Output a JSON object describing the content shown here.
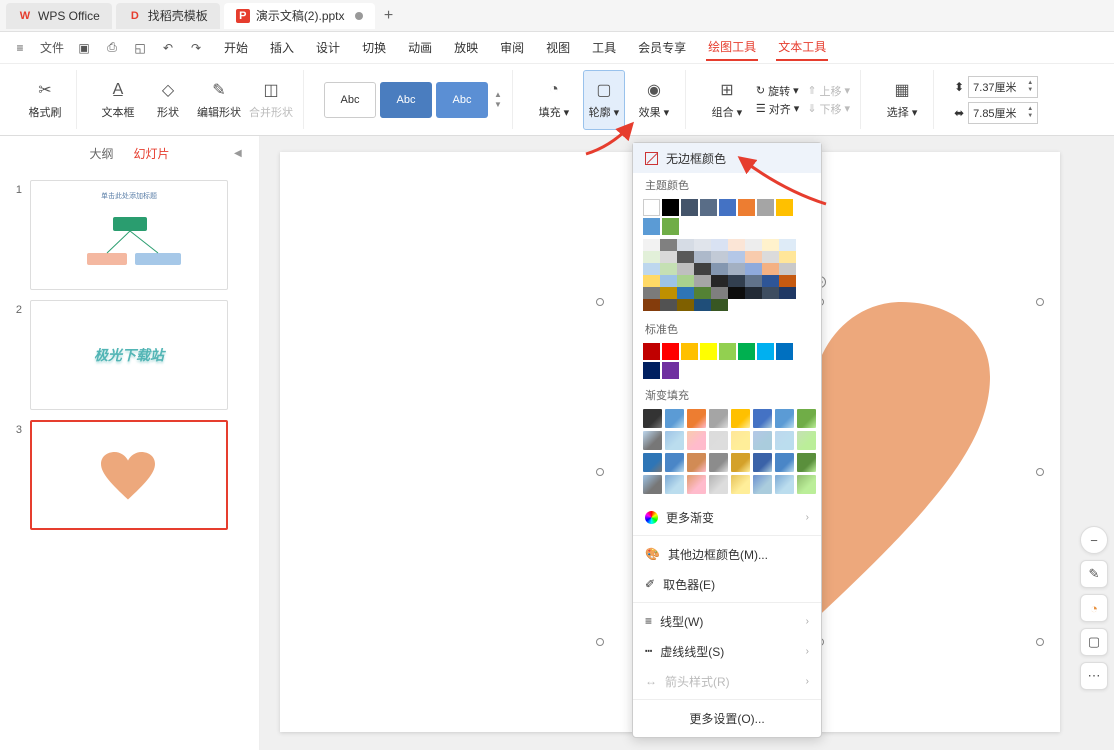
{
  "tabs": {
    "wps": "WPS Office",
    "docer": "找稻壳模板",
    "file": "演示文稿(2).pptx"
  },
  "menu": {
    "file": "文件",
    "items": [
      "开始",
      "插入",
      "设计",
      "切换",
      "动画",
      "放映",
      "审阅",
      "视图",
      "工具",
      "会员专享",
      "绘图工具",
      "文本工具"
    ]
  },
  "ribbon": {
    "format_painter": "格式刷",
    "textbox": "文本框",
    "shapes": "形状",
    "edit_shape": "编辑形状",
    "merge_shape": "合并形状",
    "style_label": "Abc",
    "fill": "填充",
    "outline": "轮廓",
    "effects": "效果",
    "group": "组合",
    "rotate": "旋转",
    "align": "对齐",
    "up": "上移",
    "down": "下移",
    "select": "选择",
    "width": "7.37厘米",
    "height": "7.85厘米"
  },
  "side": {
    "outline": "大纲",
    "slides": "幻灯片",
    "n1": "1",
    "n2": "2",
    "n3": "3",
    "s2text": "极光下载站",
    "s1title": "单击此处添加标题"
  },
  "dropdown": {
    "no_outline": "无边框颜色",
    "theme_colors": "主题颜色",
    "standard_colors": "标准色",
    "gradient_fill": "渐变填充",
    "more_gradients": "更多渐变",
    "more_colors": "其他边框颜色(M)...",
    "eyedropper": "取色器(E)",
    "line_style": "线型(W)",
    "dash_style": "虚线线型(S)",
    "arrow_style": "箭头样式(R)",
    "more_settings": "更多设置(O)..."
  },
  "theme_row1": [
    "#ffffff",
    "#000000",
    "#44546a",
    "#596d87",
    "#4472c4",
    "#ed7d31",
    "#a5a5a5",
    "#ffc000",
    "#5b9bd5",
    "#70ad47"
  ],
  "theme_shades": [
    [
      "#f2f2f2",
      "#808080",
      "#d6dce5",
      "#e0e4eb",
      "#d9e2f3",
      "#fbe5d6",
      "#ededed",
      "#fff2cc",
      "#deebf7",
      "#e2f0d9"
    ],
    [
      "#d9d9d9",
      "#595959",
      "#adb9ca",
      "#c2cad6",
      "#b4c7e7",
      "#f8cbad",
      "#dbdbdb",
      "#ffe699",
      "#bdd7ee",
      "#c5e0b4"
    ],
    [
      "#bfbfbf",
      "#404040",
      "#8497b0",
      "#a3b0c2",
      "#8faadc",
      "#f4b183",
      "#c9c9c9",
      "#ffd966",
      "#9dc3e6",
      "#a9d18e"
    ],
    [
      "#a6a6a6",
      "#262626",
      "#323f4f",
      "#61738b",
      "#2e5597",
      "#c55a11",
      "#7b7b7b",
      "#bf9000",
      "#2e75b6",
      "#548235"
    ],
    [
      "#7f7f7f",
      "#0d0d0d",
      "#222a35",
      "#3e4d60",
      "#1f3864",
      "#843c0c",
      "#525252",
      "#7f6000",
      "#1f4e79",
      "#385723"
    ]
  ],
  "standard": [
    "#c00000",
    "#ff0000",
    "#ffc000",
    "#ffff00",
    "#92d050",
    "#00b050",
    "#00b0f0",
    "#0070c0",
    "#002060",
    "#7030a0"
  ],
  "gradients": [
    [
      "#333",
      "#5b9bd5",
      "#ed7d31",
      "#a5a5a5",
      "#ffc000",
      "#4472c4",
      "#5b9bd5",
      "#70ad47"
    ],
    [
      "#bdd7ee",
      "#9dc3e6",
      "#f8cbad",
      "#dbdbdb",
      "#ffe699",
      "#b4c7e7",
      "#bdd7ee",
      "#c5e0b4"
    ],
    [
      "#2e75b6",
      "#4a86c7",
      "#d18b55",
      "#8c8c8c",
      "#d4a12a",
      "#3a62a8",
      "#4a86c7",
      "#5a8f3c"
    ],
    [
      "#9dc3e6",
      "#7aa8d4",
      "#e09c6a",
      "#b3b3b3",
      "#e6c158",
      "#6a8fcf",
      "#7aa8d4",
      "#8fbb6e"
    ]
  ]
}
